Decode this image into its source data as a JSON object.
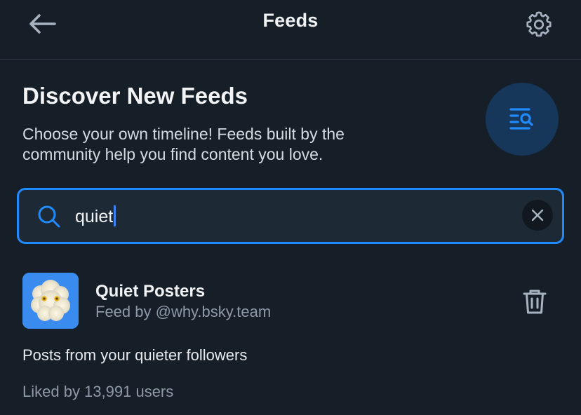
{
  "header": {
    "title": "Feeds",
    "back_icon": "arrow-left-icon",
    "settings_icon": "gear-icon"
  },
  "discover": {
    "title": "Discover New Feeds",
    "description": "Choose your own timeline! Feeds built by the community help you find content you love.",
    "icon": "list-search-icon"
  },
  "search": {
    "value": "quiet",
    "icon": "search-icon",
    "clear_icon": "close-icon"
  },
  "feeds": [
    {
      "name": "Quiet Posters",
      "by": "Feed by @why.bsky.team",
      "description": "Posts from your quieter followers",
      "likes": "Liked by 13,991 users",
      "action_icon": "trash-icon"
    }
  ],
  "colors": {
    "background": "#161e27",
    "accent": "#208bfe",
    "badge_bg": "#16365a",
    "muted_text": "#8e9aa8"
  }
}
